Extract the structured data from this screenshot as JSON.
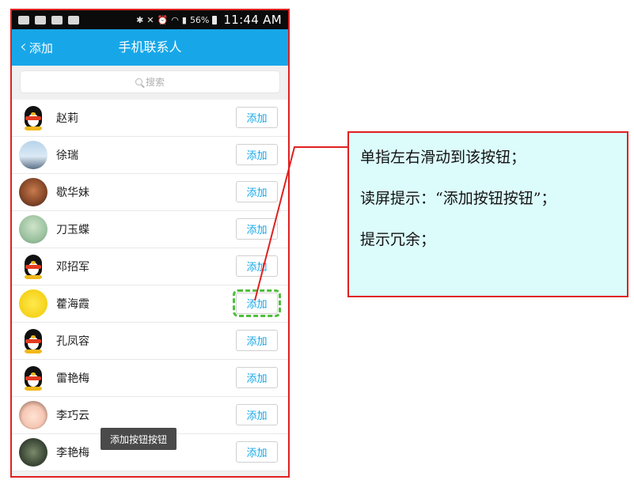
{
  "status_bar": {
    "battery": "56%",
    "time": "11:44 AM"
  },
  "header": {
    "back_label": "添加",
    "title": "手机联系人"
  },
  "search": {
    "placeholder": "搜索"
  },
  "contacts": [
    {
      "name": "赵莉",
      "avatar": "qq-penguin",
      "button": "添加"
    },
    {
      "name": "徐瑞",
      "avatar": "photo",
      "button": "添加"
    },
    {
      "name": "歇华妹",
      "avatar": "photo",
      "button": "添加"
    },
    {
      "name": "刀玉蝶",
      "avatar": "photo",
      "button": "添加"
    },
    {
      "name": "邓招军",
      "avatar": "qq-penguin",
      "button": "添加"
    },
    {
      "name": "藿海霞",
      "avatar": "photo",
      "button": "添加",
      "focused": true
    },
    {
      "name": "孔凤容",
      "avatar": "qq-penguin",
      "button": "添加"
    },
    {
      "name": "雷艳梅",
      "avatar": "qq-penguin",
      "button": "添加"
    },
    {
      "name": "李巧云",
      "avatar": "photo",
      "button": "添加"
    },
    {
      "name": "李艳梅",
      "avatar": "photo",
      "button": "添加"
    }
  ],
  "toast": "添加按钮按钮",
  "annotation": {
    "lines": [
      "单指左右滑动到该按钮；",
      "读屏提示：“添加按钮按钮”；",
      "提示冗余；"
    ]
  },
  "colors": {
    "accent": "#17a7e8",
    "frame": "#e02020",
    "focus": "#4fbe3c",
    "callout_bg": "#dcfcfc"
  }
}
